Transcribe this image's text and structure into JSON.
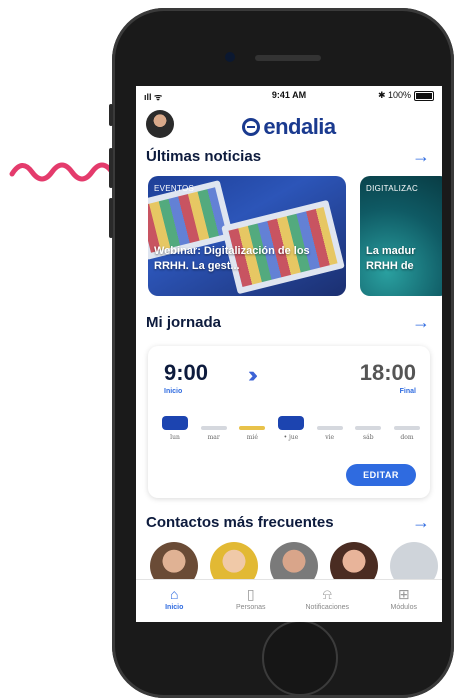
{
  "status_bar": {
    "signal": "ıll ᯤ",
    "time": "9:41 AM",
    "battery": "✱ 100%"
  },
  "app": {
    "logo_text": "endalia"
  },
  "news_section": {
    "title": "Últimas noticias",
    "cards": [
      {
        "tag": "EVENTOS",
        "headline": "Webinar: Digitalización de los RRHH. La gest..."
      },
      {
        "tag": "DIGITALIZAC",
        "headline": "La madur RRHH de"
      }
    ]
  },
  "jornada_section": {
    "title": "Mi jornada",
    "start_time": "9:00",
    "start_label": "Inicio",
    "end_time": "18:00",
    "end_label": "Final",
    "days": [
      "lun",
      "mar",
      "mié",
      "• jue",
      "vie",
      "sáb",
      "dom"
    ],
    "edit_label": "EDITAR"
  },
  "contacts_section": {
    "title": "Contactos más frecuentes"
  },
  "tabbar": {
    "items": [
      {
        "label": "Inicio",
        "icon": "home-icon"
      },
      {
        "label": "Personas",
        "icon": "person-icon"
      },
      {
        "label": "Notificaciones",
        "icon": "bell-icon"
      },
      {
        "label": "Módulos",
        "icon": "grid-icon"
      }
    ]
  },
  "colors": {
    "brand": "#1a3a8f",
    "accent": "#2f6be0",
    "squiggle": "#e43b6c"
  }
}
